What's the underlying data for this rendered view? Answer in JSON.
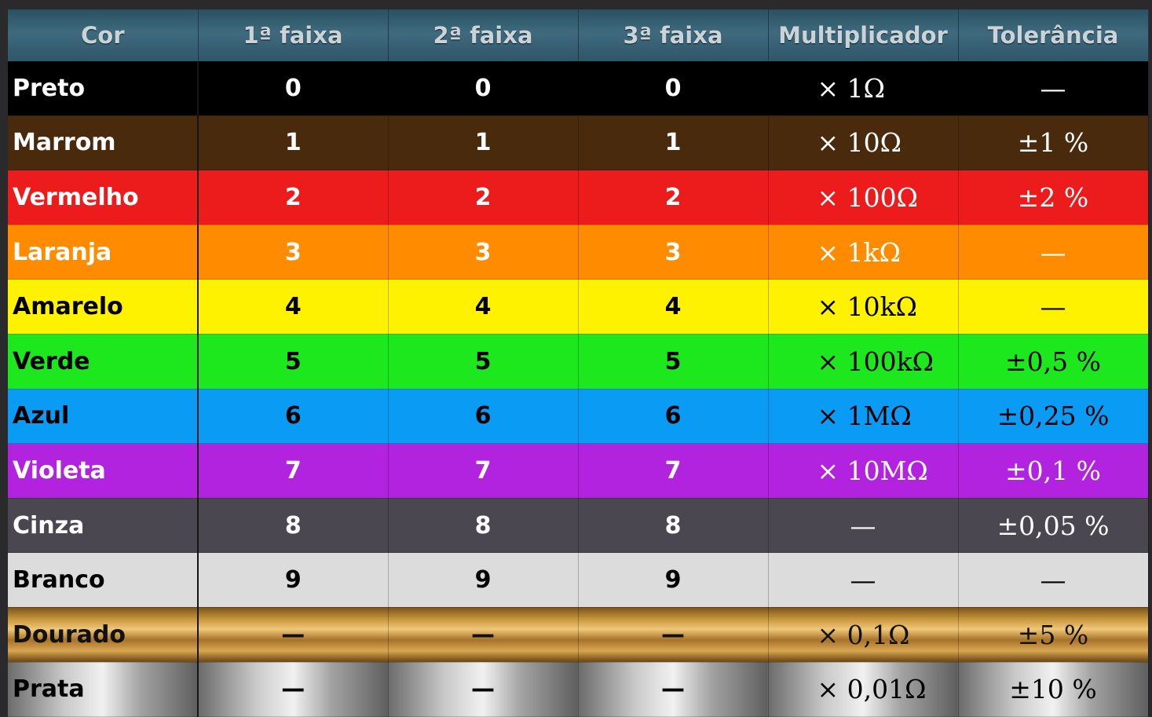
{
  "headers": [
    "Cor",
    "1ª faixa",
    "2ª faixa",
    "3ª faixa",
    "Multiplicador",
    "Tolerância"
  ],
  "rows": [
    {
      "cor": "Preto",
      "f1": "0",
      "f2": "0",
      "f3": "0",
      "mult": "× 1Ω",
      "tol": "—",
      "bg": "#000000",
      "fg": "#ffffff"
    },
    {
      "cor": "Marrom",
      "f1": "1",
      "f2": "1",
      "f3": "1",
      "mult": "× 10Ω",
      "tol": "±1 %",
      "bg": "#4a2a0c",
      "fg": "#ffffff"
    },
    {
      "cor": "Vermelho",
      "f1": "2",
      "f2": "2",
      "f3": "2",
      "mult": "× 100Ω",
      "tol": "±2 %",
      "bg": "#ec1c1c",
      "fg": "#ffffff"
    },
    {
      "cor": "Laranja",
      "f1": "3",
      "f2": "3",
      "f3": "3",
      "mult": "× 1kΩ",
      "tol": "—",
      "bg": "#ff8c00",
      "fg": "#ffffff"
    },
    {
      "cor": "Amarelo",
      "f1": "4",
      "f2": "4",
      "f3": "4",
      "mult": "× 10kΩ",
      "tol": "—",
      "bg": "#fff200",
      "fg": "#000000"
    },
    {
      "cor": "Verde",
      "f1": "5",
      "f2": "5",
      "f3": "5",
      "mult": "× 100kΩ",
      "tol": "±0,5 %",
      "bg": "#1de81d",
      "fg": "#000000"
    },
    {
      "cor": "Azul",
      "f1": "6",
      "f2": "6",
      "f3": "6",
      "mult": "× 1MΩ",
      "tol": "±0,25 %",
      "bg": "#0a9bf5",
      "fg": "#000000"
    },
    {
      "cor": "Violeta",
      "f1": "7",
      "f2": "7",
      "f3": "7",
      "mult": "× 10MΩ",
      "tol": "±0,1 %",
      "bg": "#b223e0",
      "fg": "#ffffff"
    },
    {
      "cor": "Cinza",
      "f1": "8",
      "f2": "8",
      "f3": "8",
      "mult": "—",
      "tol": "±0,05 %",
      "bg": "#4a4750",
      "fg": "#ffffff"
    },
    {
      "cor": "Branco",
      "f1": "9",
      "f2": "9",
      "f3": "9",
      "mult": "—",
      "tol": "—",
      "bg": "#dcdcdc",
      "fg": "#000000"
    },
    {
      "cor": "Dourado",
      "f1": "—",
      "f2": "—",
      "f3": "—",
      "mult": "× 0,1Ω",
      "tol": "±5 %",
      "bg": "gold",
      "fg": "#111111"
    },
    {
      "cor": "Prata",
      "f1": "—",
      "f2": "—",
      "f3": "—",
      "mult": "× 0,01Ω",
      "tol": "±10 %",
      "bg": "silver",
      "fg": "#000000"
    }
  ]
}
